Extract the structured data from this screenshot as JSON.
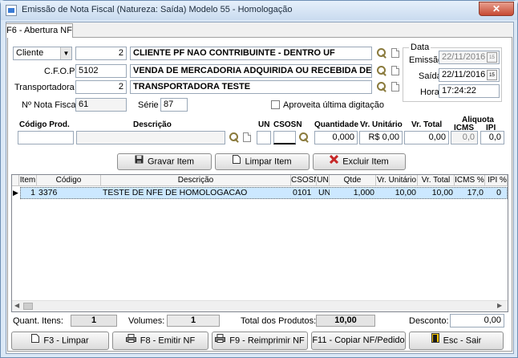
{
  "window": {
    "title": "Emissão de Nota Fiscal (Natureza: Saída) Modelo 55 - Homologação",
    "close": "✕"
  },
  "tab": {
    "label": "F6 - Abertura NF"
  },
  "header": {
    "cliente_type": "Cliente",
    "cliente_code": "2",
    "cliente_name": "CLIENTE PF NAO CONTRIBUINTE - DENTRO UF",
    "cfop_label": "C.F.O.P",
    "cfop_code": "5102",
    "cfop_desc": "VENDA DE MERCADORIA ADQUIRIDA OU RECEBIDA DE TERC",
    "transp_label": "Transportadora",
    "transp_code": "2",
    "transp_name": "TRANSPORTADORA TESTE",
    "nf_label": "Nº Nota Fiscal",
    "nf_value": "61",
    "serie_label": "Série",
    "serie_value": "87",
    "aproveita_label": "Aproveita última digitação"
  },
  "data_group": {
    "title": "Data",
    "emissao_label": "Emissão",
    "emissao_value": "22/11/2016",
    "saida_label": "Saída",
    "saida_value": "22/11/2016",
    "hora_label": "Hora",
    "hora_value": "17:24:22",
    "cal_icon": "15"
  },
  "item_entry": {
    "codigo_hdr": "Código Prod.",
    "descricao_hdr": "Descrição",
    "un_hdr": "UN",
    "csosn_hdr": "CSOSN",
    "quantidade_hdr": "Quantidade",
    "vr_unitario_hdr": "Vr. Unitário",
    "vr_total_hdr": "Vr. Total",
    "aliquota_hdr": "Aliquota",
    "icms_hdr": "ICMS",
    "ipi_hdr": "IPI",
    "quantidade": "0,000",
    "vr_unitario": "R$ 0,00",
    "vr_total": "0,00",
    "icms": "0,0",
    "ipi": "0,0"
  },
  "item_buttons": {
    "gravar": "Gravar Item",
    "limpar": "Limpar Item",
    "excluir": "Excluir Item"
  },
  "grid": {
    "columns": [
      "Item",
      "Código",
      "Descrição",
      "CSOSN",
      "UN",
      "Qtde",
      "Vr. Unitário",
      "Vr. Total",
      "ICMS %",
      "IPI %"
    ],
    "rows": [
      {
        "item": "1",
        "codigo": "3376",
        "descricao": "TESTE DE NFE DE HOMOLOGACAO",
        "csosn": "0101",
        "un": "UN",
        "qtde": "1,000",
        "vr_unitario": "10,00",
        "vr_total": "10,00",
        "icms": "17,0",
        "ipi": "0"
      }
    ]
  },
  "summary": {
    "quant_itens_label": "Quant. Itens:",
    "quant_itens": "1",
    "volumes_label": "Volumes:",
    "volumes": "1",
    "total_label": "Total dos Produtos:",
    "total": "10,00",
    "desconto_label": "Desconto:",
    "desconto": "0,00"
  },
  "footer": {
    "f3": "F3 - Limpar",
    "f8": "F8 - Emitir NF",
    "f9": "F9 - Reimprimir NF",
    "f11": "F11 - Copiar NF/Pedido",
    "esc": "Esc - Sair"
  },
  "colors": {
    "accent": "#3a7bd5",
    "selection": "#cce8ff",
    "delete": "#c62828",
    "close": "#c74a33"
  }
}
